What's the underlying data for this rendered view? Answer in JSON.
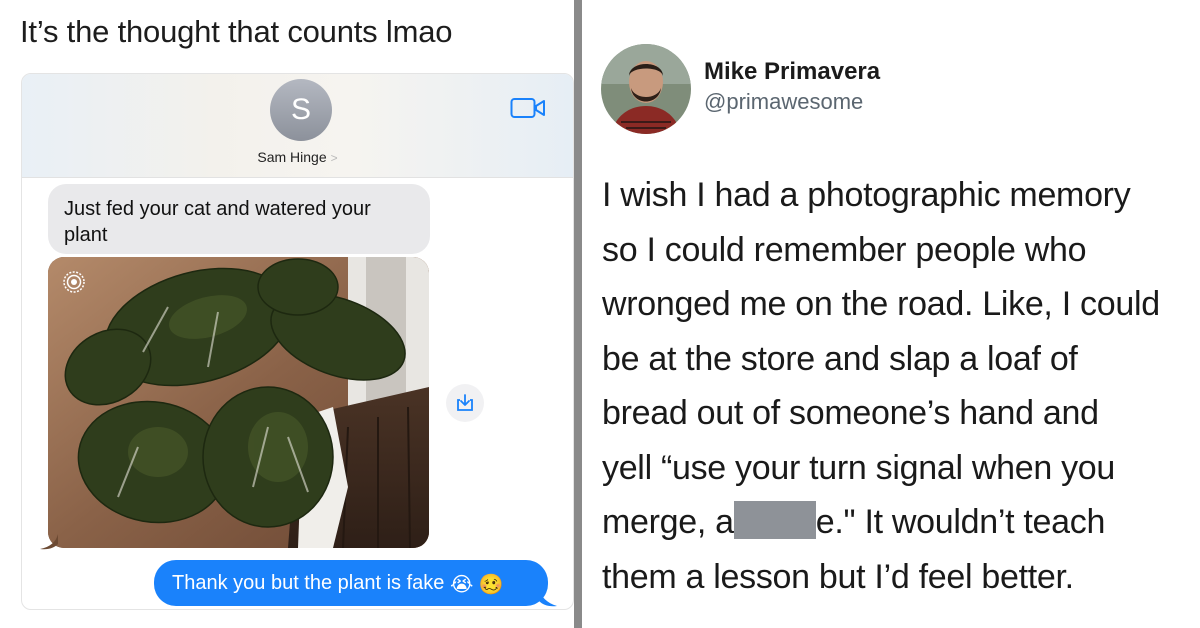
{
  "left_panel": {
    "caption": "It’s the thought that counts lmao",
    "conversation": {
      "contact_initial": "S",
      "contact_name": "Sam Hinge",
      "contact_chevron": ">",
      "incoming_message": "Just fed your cat and watered your plant",
      "outgoing_message": "Thank you but the plant is fake",
      "outgoing_emojis": [
        "😭",
        "🥴"
      ],
      "icons": {
        "video_call": "video-camera-icon",
        "live_photo": "live-photo-icon",
        "save_image": "download-icon"
      }
    },
    "colors": {
      "outgoing_bubble": "#1a82fb",
      "incoming_bubble": "#e9e9eb"
    }
  },
  "right_panel": {
    "author_name": "Mike Primavera",
    "author_handle": "@primawesome",
    "tweet_lines": [
      "I wish I had a photographic memory",
      "so I could remember people who",
      "wronged me on the road. Like, I could",
      "be at the store and slap a loaf of",
      "bread out of someone’s hand and",
      "yell “use your turn signal when you"
    ],
    "tweet_line_7_before": "merge, a",
    "tweet_line_7_after": "e.\" It wouldn’t teach",
    "tweet_line_8": "them a lesson but I’d feel better."
  }
}
